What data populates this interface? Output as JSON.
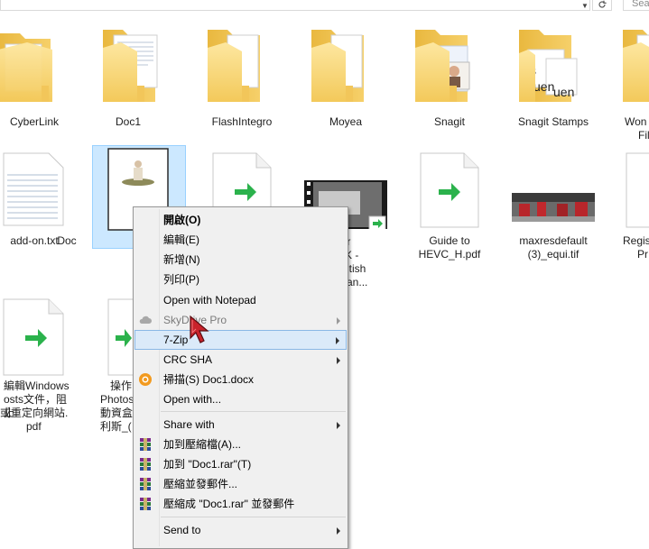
{
  "window": {
    "search_placeholder": "Sea"
  },
  "items": [
    {
      "label": "CyberLink"
    },
    {
      "label": "Doc1"
    },
    {
      "label": "FlashIntegro"
    },
    {
      "label": "Moyea"
    },
    {
      "label": "Snagit"
    },
    {
      "label": "Snagit Stamps"
    },
    {
      "label_1": "Won",
      "label_2": "Fil"
    },
    {
      "label": "add-on.txt"
    },
    {
      "label": "Doc"
    },
    {
      "label_1": "Bear",
      "label_2": "t in 4K -",
      "label_3": "g British",
      "label_4": "a, Can..."
    },
    {
      "label_1": "Guide to",
      "label_2": "HEVC_H.pdf"
    },
    {
      "label_1": "maxresdefault",
      "label_2": "(3)_equi.tif"
    },
    {
      "label_1": "Regis",
      "label_2": "Pr"
    },
    {
      "label_1": "編輯Windows",
      "label_2": "osts文件，阻止",
      "label_3": "或重定向網站.",
      "label_4": "pdf"
    },
    {
      "label_1": "操作",
      "label_2": "Photos",
      "label_3": "動資盒",
      "label_4": "利斯_("
    }
  ],
  "stamp_texts": [
    "s",
    "uen",
    "uen"
  ],
  "context_menu": {
    "items": [
      {
        "label": "開啟(O)"
      },
      {
        "label": "編輯(E)"
      },
      {
        "label": "新增(N)"
      },
      {
        "label": "列印(P)"
      },
      {
        "label": "Open with Notepad"
      },
      {
        "label": "SkyDrive Pro"
      },
      {
        "label": "7-Zip"
      },
      {
        "label": "CRC SHA"
      },
      {
        "label": "掃描(S) Doc1.docx"
      },
      {
        "label": "Open with..."
      },
      {
        "label": "Share with"
      },
      {
        "label": "加到壓縮檔(A)..."
      },
      {
        "label": "加到 \"Doc1.rar\"(T)"
      },
      {
        "label": "壓縮並發郵件..."
      },
      {
        "label": "壓縮成 \"Doc1.rar\" 並發郵件"
      },
      {
        "label": "Send to"
      }
    ]
  },
  "colors": {
    "selection_bg": "#cce8ff",
    "selection_border": "#99d1ff",
    "menu_bg": "#f0f0f0",
    "menu_highlight": "#dbeaf9",
    "folder_yellow": "#f8d775",
    "green_arrow": "#2bb24c"
  }
}
